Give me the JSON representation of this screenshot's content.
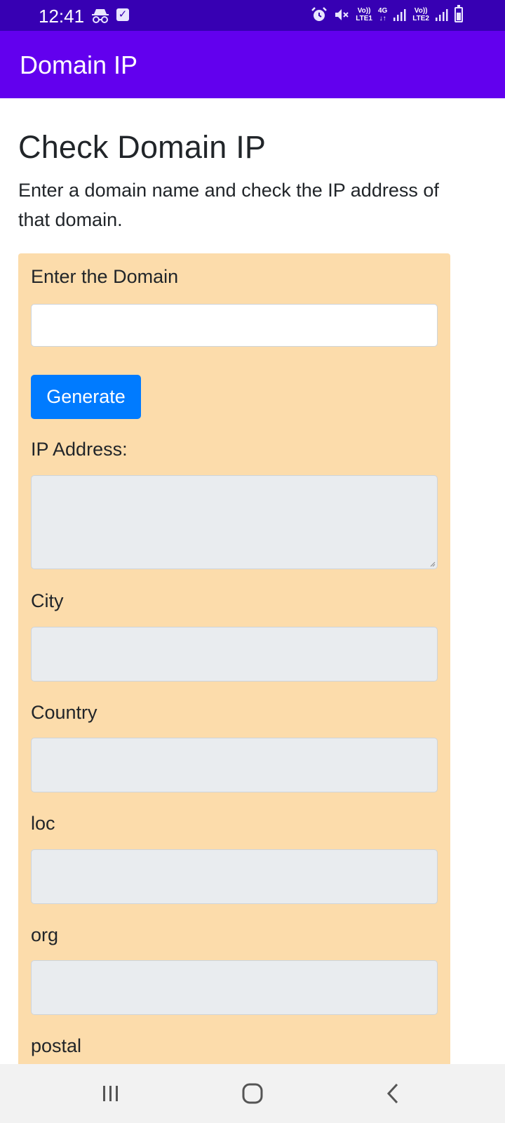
{
  "status_bar": {
    "time": "12:41",
    "net1_top": "Vo))",
    "net1_bottom": "LTE1",
    "net_type_top": "4G",
    "net_type_bottom": "↓↑",
    "net2_top": "Vo))",
    "net2_bottom": "LTE2"
  },
  "app_bar": {
    "title": "Domain IP"
  },
  "page": {
    "title": "Check Domain IP",
    "description": "Enter a domain name and check the IP address of that domain."
  },
  "form": {
    "domain_label": "Enter the Domain",
    "domain_value": "",
    "domain_placeholder": "",
    "generate_label": "Generate",
    "ip_label": "IP Address:",
    "ip_value": "",
    "city_label": "City",
    "city_value": "",
    "country_label": "Country",
    "country_value": "",
    "loc_label": "loc",
    "loc_value": "",
    "org_label": "org",
    "org_value": "",
    "postal_label": "postal"
  },
  "colors": {
    "status_bar": "#3700b3",
    "app_bar": "#6200ee",
    "card": "#fcdcab",
    "button": "#007bff",
    "readonly_field": "#e9ecef"
  },
  "icons": {
    "status": [
      "incognito-icon",
      "checkbox-notification-icon",
      "alarm-icon",
      "mute-icon",
      "signal-icon",
      "battery-icon"
    ],
    "navigation": [
      "recent-apps-icon",
      "home-icon",
      "back-icon"
    ]
  }
}
